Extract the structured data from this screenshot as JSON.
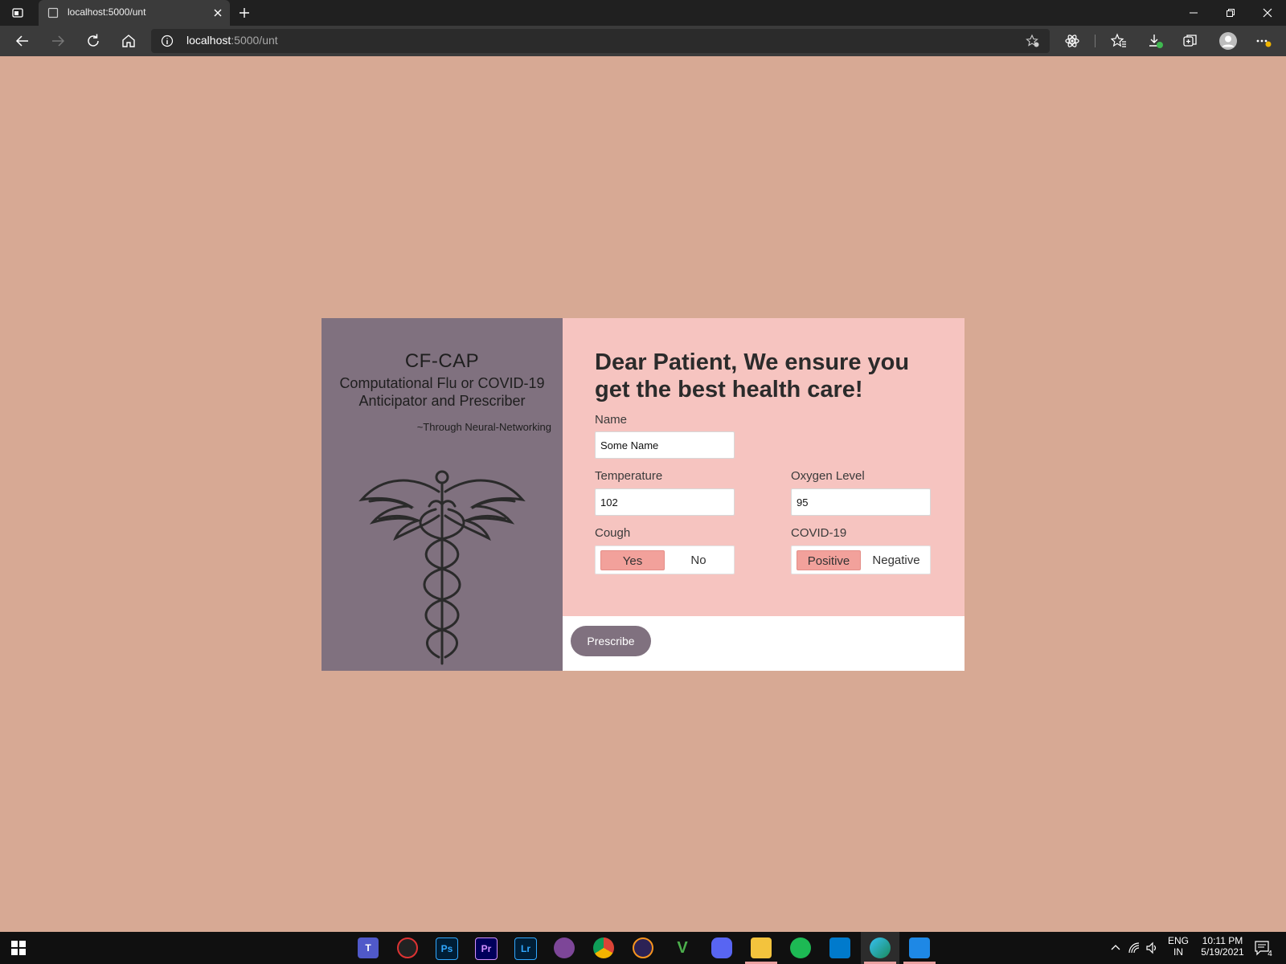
{
  "browser": {
    "tab_title": "localhost:5000/unt",
    "url_host": "localhost",
    "url_path": ":5000/unt"
  },
  "brand": {
    "title": "CF-CAP",
    "subtitle_line1": "Computational Flu or COVID-19",
    "subtitle_line2": "Anticipator and Prescriber",
    "tagline": "~Through Neural-Networking"
  },
  "form": {
    "headline": "Dear Patient, We ensure you get the best health care!",
    "name": {
      "label": "Name",
      "value": "Some Name"
    },
    "temperature": {
      "label": "Temperature",
      "value": "102"
    },
    "oxygen": {
      "label": "Oxygen Level",
      "value": "95"
    },
    "cough": {
      "label": "Cough",
      "options": [
        "Yes",
        "No"
      ],
      "selected": "Yes"
    },
    "covid": {
      "label": "COVID-19",
      "options": [
        "Positive",
        "Negative"
      ],
      "selected": "Positive"
    },
    "submit_label": "Prescribe"
  },
  "colors": {
    "page_bg": "#d7a994",
    "left_panel": "#80717f",
    "right_panel": "#f6c4c0",
    "selected_option": "#f2a19b"
  },
  "taskbar": {
    "apps": [
      "teams-icon",
      "speedtest-icon",
      "photoshop-icon",
      "premiere-icon",
      "lightroom-icon",
      "tor-icon",
      "chrome-icon",
      "eclipse-icon",
      "vim-icon",
      "discord-icon",
      "file-explorer-icon",
      "spotify-icon",
      "vscode-icon",
      "edge-icon",
      "media-player-icon"
    ],
    "photoshop_label": "Ps",
    "premiere_label": "Pr",
    "lightroom_label": "Lr",
    "language": "ENG",
    "region": "IN",
    "time": "10:11 PM",
    "date": "5/19/2021",
    "notification_count": "4"
  }
}
